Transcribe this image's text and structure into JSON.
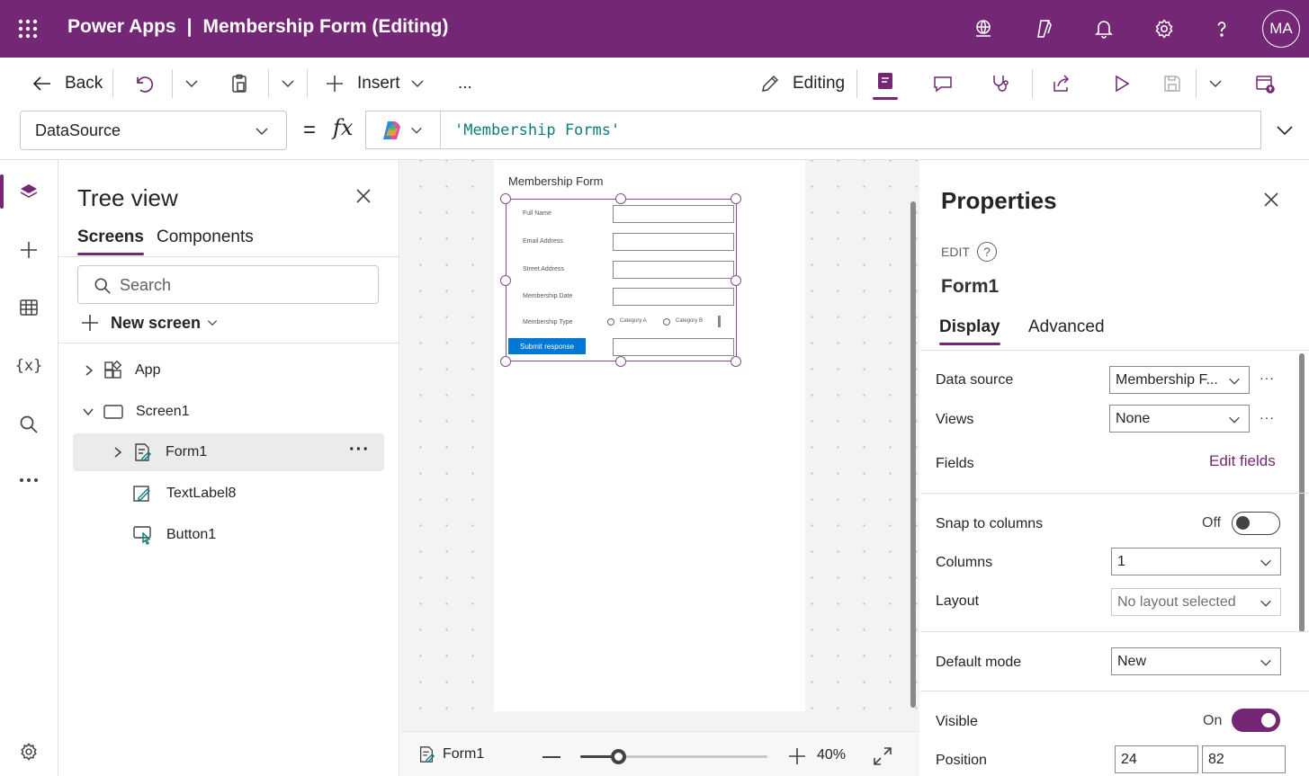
{
  "app": {
    "product": "Power Apps",
    "document": "Membership Form (Editing)",
    "avatar": "MA"
  },
  "command_bar": {
    "back": "Back",
    "insert": "Insert",
    "more": "...",
    "editing": "Editing"
  },
  "formula_bar": {
    "property": "DataSource",
    "equals": "=",
    "fx": "fx",
    "formula": "'Membership Forms'"
  },
  "tree": {
    "title": "Tree view",
    "tabs": [
      "Screens",
      "Components"
    ],
    "search_placeholder": "Search",
    "new_screen": "New screen",
    "items": [
      {
        "label": "App"
      },
      {
        "label": "Screen1"
      },
      {
        "label": "Form1",
        "more": "···"
      },
      {
        "label": "TextLabel8"
      },
      {
        "label": "Button1"
      }
    ]
  },
  "canvas": {
    "screen_title": "Membership Form",
    "fields": [
      "Full Name",
      "Email Address",
      "Street Address",
      "Membership Date",
      "Membership Type"
    ],
    "radio_options": [
      "Category A",
      "Category B"
    ],
    "submit": "Submit response",
    "bottom": {
      "selected": "Form1",
      "zoom": "40%",
      "zoom_fraction": 0.2
    }
  },
  "properties": {
    "title": "Properties",
    "mode": "EDIT",
    "control": "Form1",
    "tabs": [
      "Display",
      "Advanced"
    ],
    "data_source_label": "Data source",
    "data_source_value": "Membership F...",
    "views_label": "Views",
    "views_value": "None",
    "fields_label": "Fields",
    "edit_fields": "Edit fields",
    "snap_label": "Snap to columns",
    "snap_state": "Off",
    "columns_label": "Columns",
    "columns_value": "1",
    "layout_label": "Layout",
    "layout_value": "No layout selected",
    "default_mode_label": "Default mode",
    "default_mode_value": "New",
    "visible_label": "Visible",
    "visible_state": "On",
    "position_label": "Position",
    "position_x": "24",
    "position_y": "82",
    "ellipsis": "···"
  },
  "colors": {
    "brand": "#742774",
    "accent": "#742774",
    "link": "#742774",
    "canvas": "#f3f3f3",
    "submit_button": "#0078d4",
    "formula_text": "#107c78"
  }
}
